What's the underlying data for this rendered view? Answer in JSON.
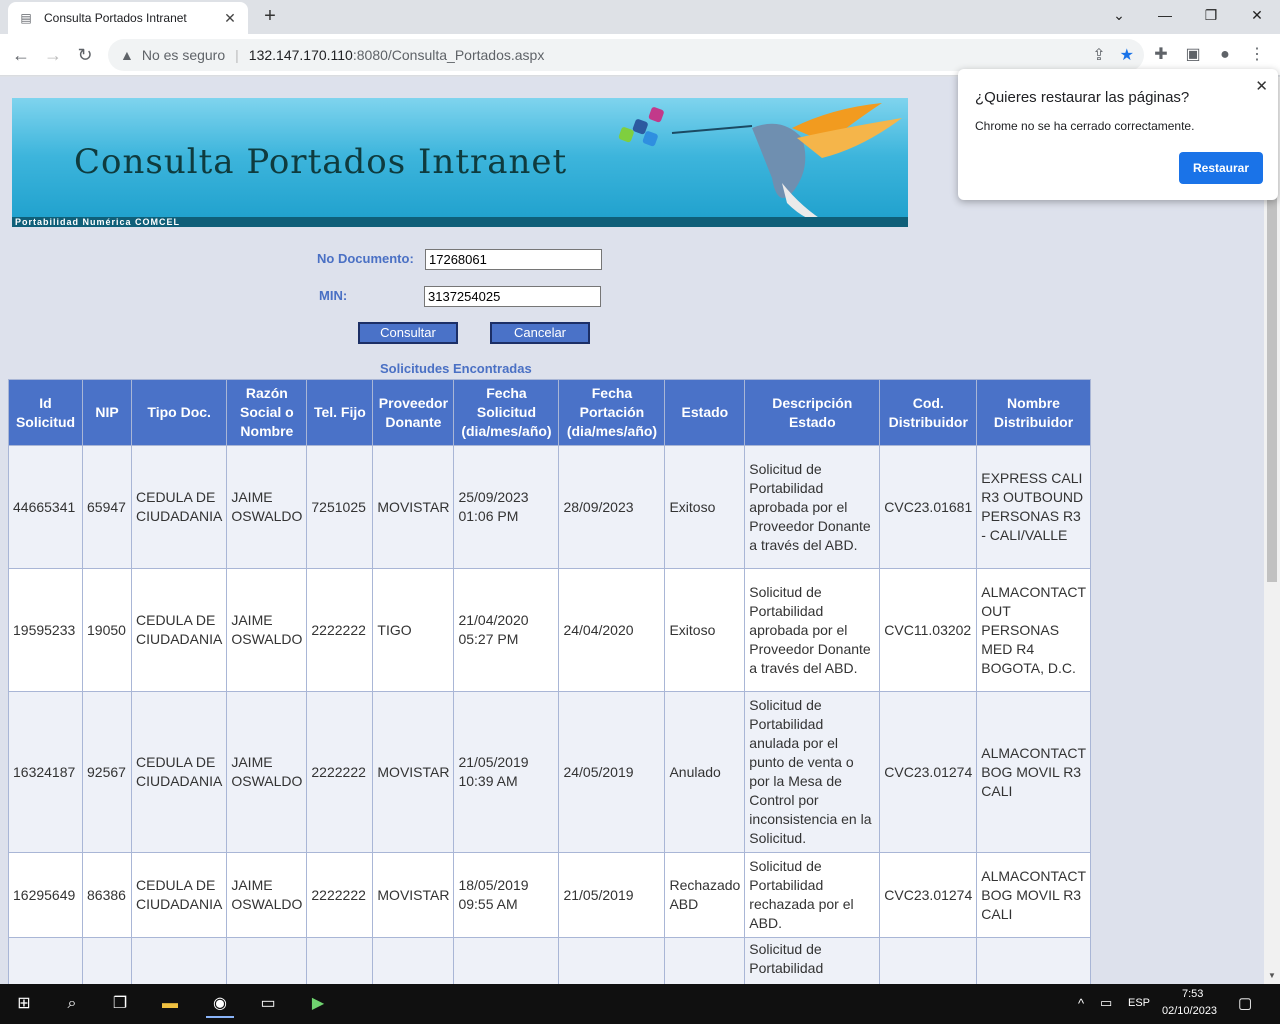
{
  "browser": {
    "tab_title": "Consulta Portados Intranet",
    "url_warning": "No es seguro",
    "url_host": "132.147.170.110",
    "url_path": ":8080/Consulta_Portados.aspx"
  },
  "banner": {
    "title": "Consulta Portados Intranet",
    "subtitle": "Portabilidad Numérica COMCEL"
  },
  "form": {
    "doc_label": "No Documento:",
    "doc_value": "17268061",
    "min_label": "MIN:",
    "min_value": "3137254025",
    "consultar_label": "Consultar",
    "cancelar_label": "Cancelar"
  },
  "results": {
    "caption": "Solicitudes Encontradas",
    "headers": [
      "Id Solicitud",
      "NIP",
      "Tipo Doc.",
      "Razón Social o Nombre",
      "Tel. Fijo",
      "Proveedor Donante",
      "Fecha Solicitud (dia/mes/año)",
      "Fecha Portación (dia/mes/año)",
      "Estado",
      "Descripción Estado",
      "Cod. Distribuidor",
      "Nombre Distribuidor"
    ],
    "rows": [
      [
        "44665341",
        "65947",
        "CEDULA DE CIUDADANIA",
        "JAIME OSWALDO",
        "7251025",
        "MOVISTAR",
        "25/09/2023 01:06 PM",
        "28/09/2023",
        "Exitoso",
        "Solicitud de Portabilidad aprobada por el Proveedor Donante a través del ABD.",
        "CVC23.01681",
        "EXPRESS CALI R3 OUTBOUND PERSONAS R3 - CALI/VALLE"
      ],
      [
        "19595233",
        "19050",
        "CEDULA DE CIUDADANIA",
        "JAIME OSWALDO",
        "2222222",
        "TIGO",
        "21/04/2020 05:27 PM",
        "24/04/2020",
        "Exitoso",
        "Solicitud de Portabilidad aprobada por el Proveedor Donante a través del ABD.",
        "CVC11.03202",
        "ALMACONTACT OUT PERSONAS MED R4 BOGOTA, D.C."
      ],
      [
        "16324187",
        "92567",
        "CEDULA DE CIUDADANIA",
        "JAIME OSWALDO",
        "2222222",
        "MOVISTAR",
        "21/05/2019 10:39 AM",
        "24/05/2019",
        "Anulado",
        "Solicitud de Portabilidad anulada por el punto de venta o por la Mesa de Control por inconsistencia en la Solicitud.",
        "CVC23.01274",
        "ALMACONTACT BOG MOVIL R3 CALI"
      ],
      [
        "16295649",
        "86386",
        "CEDULA DE CIUDADANIA",
        "JAIME OSWALDO",
        "2222222",
        "MOVISTAR",
        "18/05/2019 09:55 AM",
        "21/05/2019",
        "Rechazado ABD",
        "Solicitud de Portabilidad rechazada por el ABD.",
        "CVC23.01274",
        "ALMACONTACT BOG MOVIL R3 CALI"
      ],
      [
        "",
        "",
        "",
        "",
        "",
        "",
        "",
        "",
        "",
        "Solicitud de Portabilidad",
        "",
        ""
      ]
    ]
  },
  "popup": {
    "title": "¿Quieres restaurar las páginas?",
    "body": "Chrome no se ha cerrado correctamente.",
    "button": "Restaurar"
  },
  "taskbar": {
    "lang": "ESP",
    "time": "7:53",
    "date": "02/10/2023"
  }
}
